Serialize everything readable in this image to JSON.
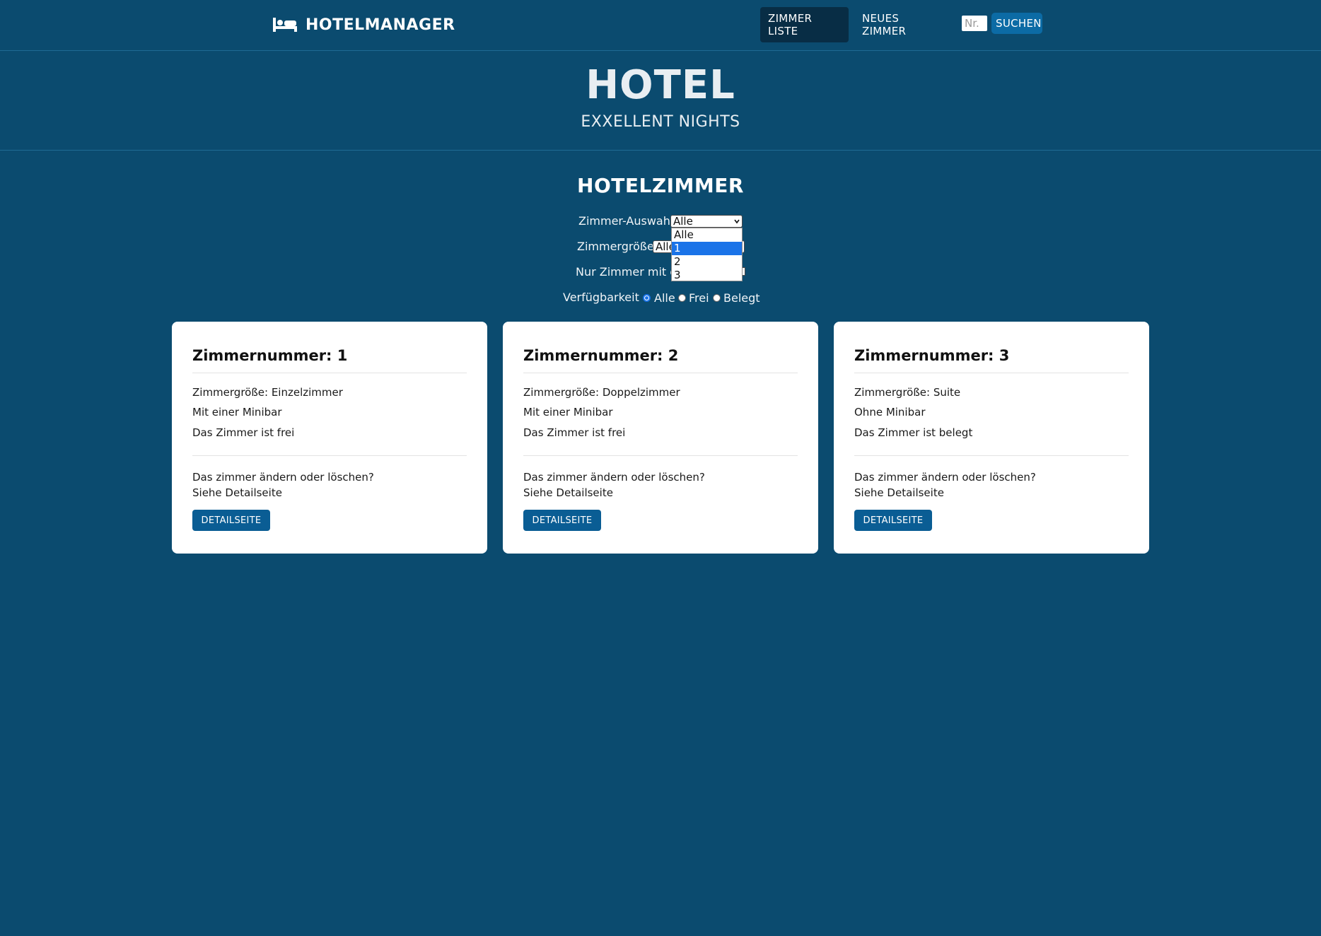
{
  "navbar": {
    "brand": "HOTELMANAGER",
    "brand_icon": "bed-icon",
    "links": [
      "ZIMMER LISTE",
      "NEUES ZIMMER"
    ],
    "search_placeholder": "Nr.",
    "search_button": "SUCHEN"
  },
  "hero": {
    "title": "HOTEL",
    "subtitle": "EXXELLENT NIGHTS"
  },
  "filters": {
    "title": "HOTELZIMMER",
    "room_select_label": "Zimmer-Auswahl",
    "room_select_value": "Alle",
    "room_select_options": [
      "Alle",
      "1",
      "2",
      "3"
    ],
    "room_select_highlighted": "1",
    "size_label": "Zimmergröße",
    "size_value": "Alle",
    "minibar_label": "Nur Zimmer mit ei",
    "availability_label": "Verfügbarkeit",
    "availability_options": [
      "Alle",
      "Frei",
      "Belegt"
    ],
    "availability_selected": "Alle"
  },
  "rooms": [
    {
      "title": "Zimmernummer: 1",
      "size": "Zimmergröße: Einzelzimmer",
      "minibar": "Mit einer Minibar",
      "status": "Das Zimmer ist frei",
      "note_line1": "Das zimmer ändern oder löschen?",
      "note_line2": "Siehe Detailseite",
      "button": "DETAILSEITE"
    },
    {
      "title": "Zimmernummer: 2",
      "size": "Zimmergröße: Doppelzimmer",
      "minibar": "Mit einer Minibar",
      "status": "Das Zimmer ist frei",
      "note_line1": "Das zimmer ändern oder löschen?",
      "note_line2": "Siehe Detailseite",
      "button": "DETAILSEITE"
    },
    {
      "title": "Zimmernummer: 3",
      "size": "Zimmergröße: Suite",
      "minibar": "Ohne Minibar",
      "status": "Das Zimmer ist belegt",
      "note_line1": "Das zimmer ändern oder löschen?",
      "note_line2": "Siehe Detailseite",
      "button": "DETAILSEITE"
    }
  ],
  "colors": {
    "background": "#0b4b6f",
    "nav_active": "#082d45",
    "accent": "#0c6ba5",
    "button": "#0a5d94",
    "dropdown_highlight": "#1a73e8"
  }
}
